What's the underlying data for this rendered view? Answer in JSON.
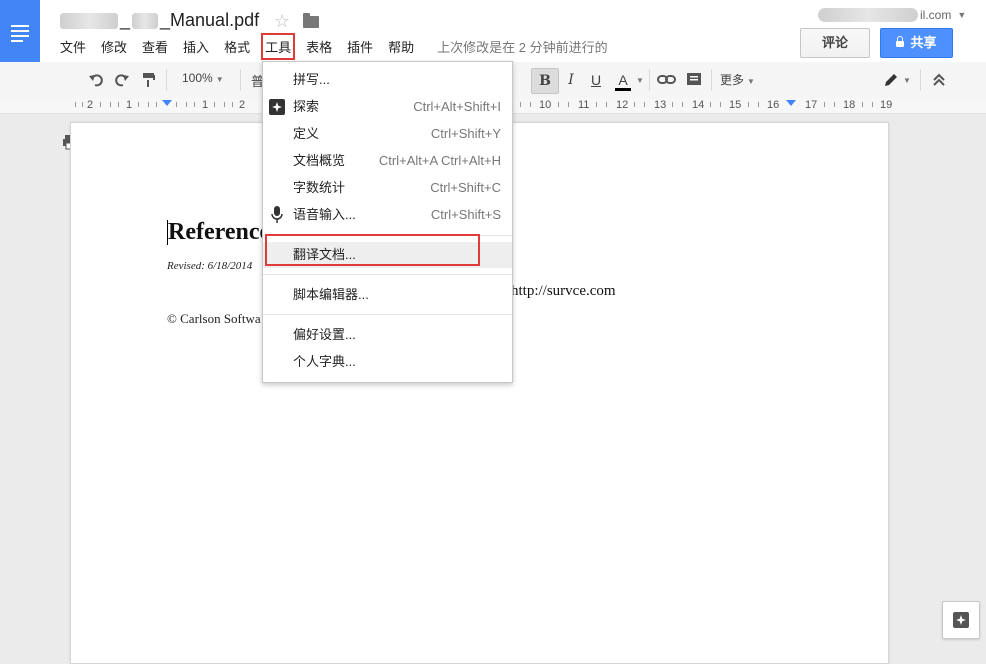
{
  "header": {
    "title_suffix": "_Manual.pdf",
    "title_sep": "_",
    "account_suffix": "il.com",
    "last_edit": "上次修改是在 2 分钟前进行的",
    "comment_label": "评论",
    "share_label": "共享"
  },
  "menubar": {
    "items": [
      "文件",
      "修改",
      "查看",
      "插入",
      "格式",
      "工具",
      "表格",
      "插件",
      "帮助"
    ]
  },
  "toolbar": {
    "zoom": "100%",
    "style_partial": "普",
    "bold": "B",
    "italic": "I",
    "underline": "U",
    "text_color": "A",
    "more": "更多"
  },
  "ruler": {
    "labels": [
      "2",
      "1",
      "1",
      "2",
      "10",
      "11",
      "12",
      "13",
      "14",
      "15",
      "16",
      "17",
      "18",
      "19"
    ]
  },
  "document": {
    "heading": "Reference",
    "revised": "Revised: 6/18/2014",
    "url": "http://survce.com",
    "copyright": "© Carlson Softwa"
  },
  "tools_menu": {
    "items": [
      {
        "label": "拼写...",
        "shortcut": ""
      },
      {
        "label": "探索",
        "shortcut": "Ctrl+Alt+Shift+I",
        "icon": "explore-icon"
      },
      {
        "label": "定义",
        "shortcut": "Ctrl+Shift+Y"
      },
      {
        "label": "文档概览",
        "shortcut": "Ctrl+Alt+A Ctrl+Alt+H"
      },
      {
        "label": "字数统计",
        "shortcut": "Ctrl+Shift+C"
      },
      {
        "label": "语音输入...",
        "shortcut": "Ctrl+Shift+S",
        "icon": "microphone-icon"
      },
      {
        "label": "翻译文档...",
        "shortcut": ""
      },
      {
        "label": "脚本编辑器...",
        "shortcut": ""
      },
      {
        "label": "偏好设置...",
        "shortcut": ""
      },
      {
        "label": "个人字典...",
        "shortcut": ""
      }
    ]
  },
  "colors": {
    "brand": "#4285f4",
    "share": "#4d90fe",
    "highlight": "#e03b3b"
  }
}
